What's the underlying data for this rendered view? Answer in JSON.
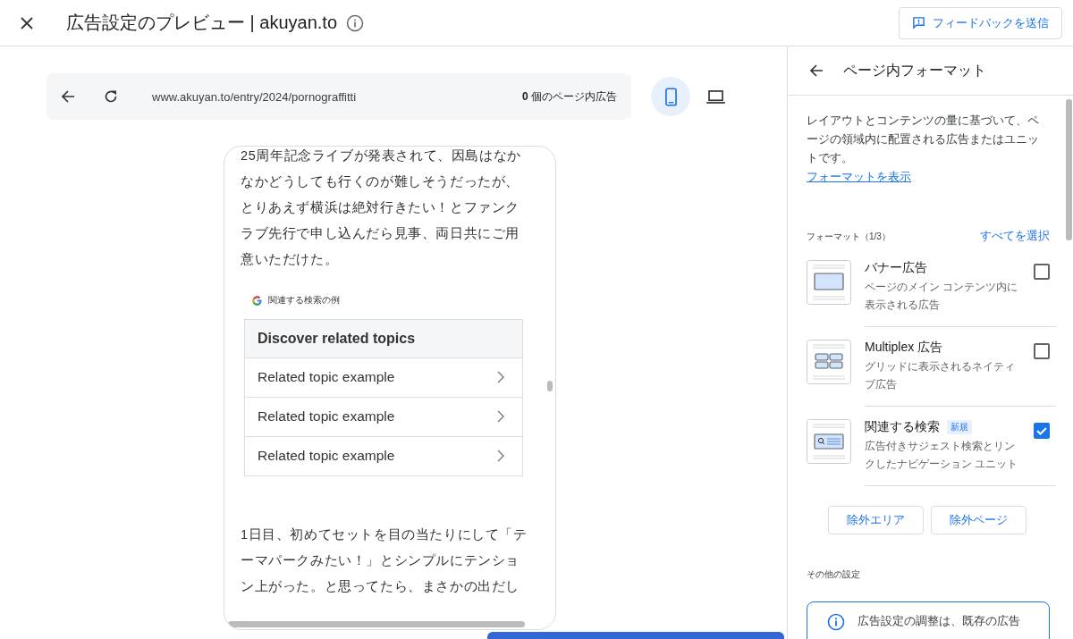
{
  "header": {
    "title": "広告設定のプレビュー | akuyan.to",
    "feedback": "フィードバックを送信"
  },
  "preview": {
    "url": "www.akuyan.to/entry/2024/pornograffitti",
    "ad_count": "**0** 個のページ内広告",
    "devices": [
      {
        "kind": "phone",
        "selected": true
      },
      {
        "kind": "laptop",
        "selected": false
      }
    ],
    "article": {
      "paragraphs": [
        "25周年記念ライブが発表されて、因島はなかなかどうしても行くのが難しそうだったが、とりあえず横浜は絶対行きたい！とファンクラブ先行で申し込んだら見事、両日共にご用意いただけた。",
        "1日目、初めてセットを目の当たりにして「テーマパークみたい！」とシンプルにテンション上がった。と思ってたら、まさかの出だし"
      ],
      "related": {
        "label": "関連する検索の例",
        "heading": "Discover related topics",
        "items": [
          "Related topic example",
          "Related topic example",
          "Related topic example"
        ]
      }
    }
  },
  "panel": {
    "title": "ページ内フォーマット",
    "description": "レイアウトとコンテンツの量に基づいて、ページの領域内に配置される広告またはユニットです。",
    "link": "フォーマットを表示",
    "formats_label": "フォーマット（1/3）",
    "select_all": "すべてを選択",
    "formats": [
      {
        "kind": "banner",
        "name": "バナー広告",
        "description": "ページのメイン コンテンツ内に表示される広告",
        "checked": false
      },
      {
        "kind": "multiplex",
        "name": "Multiplex 広告",
        "description": "グリッドに表示されるネイティブ広告",
        "checked": false
      },
      {
        "kind": "related",
        "name": "関連する検索",
        "badge": "新規",
        "description": "広告付きサジェスト検索とリンクしたナビゲーション ユニット",
        "checked": true
      }
    ],
    "buttons": [
      "除外エリア",
      "除外ページ"
    ],
    "other_label": "その他の設定",
    "info": "広告設定の調整は、既存の広告"
  }
}
